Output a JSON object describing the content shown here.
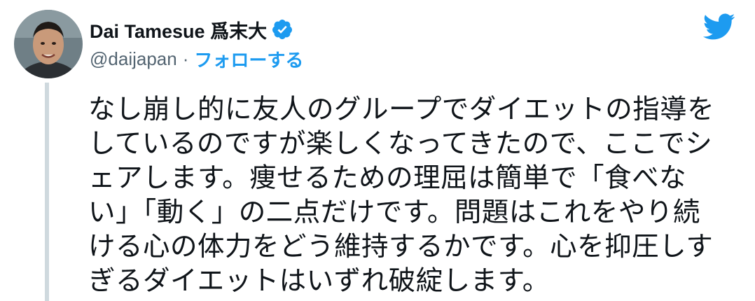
{
  "author": {
    "display_name": "Dai Tamesue 爲末大",
    "handle": "@daijapan",
    "separator": "·",
    "follow_label": "フォローする",
    "verified": true
  },
  "icons": {
    "avatar": "avatar",
    "verified": "verified-badge-icon",
    "brand": "twitter-bird-icon"
  },
  "colors": {
    "accent": "#1d9bf0",
    "secondary_text": "#536471",
    "thread_line": "#cfd9de",
    "text": "#0f1419"
  },
  "tweet": {
    "text": "なし崩し的に友人のグループでダイエットの指導を\nしているのですが楽しくなってきたので、ここでシ\nェアします。痩せるための理屈は簡単で「食べな\nい」「動く」の二点だけです。問題はこれをやり続\nける心の体力をどう維持するかです。心を抑圧しす\nぎるダイエットはいずれ破綻します。"
  }
}
